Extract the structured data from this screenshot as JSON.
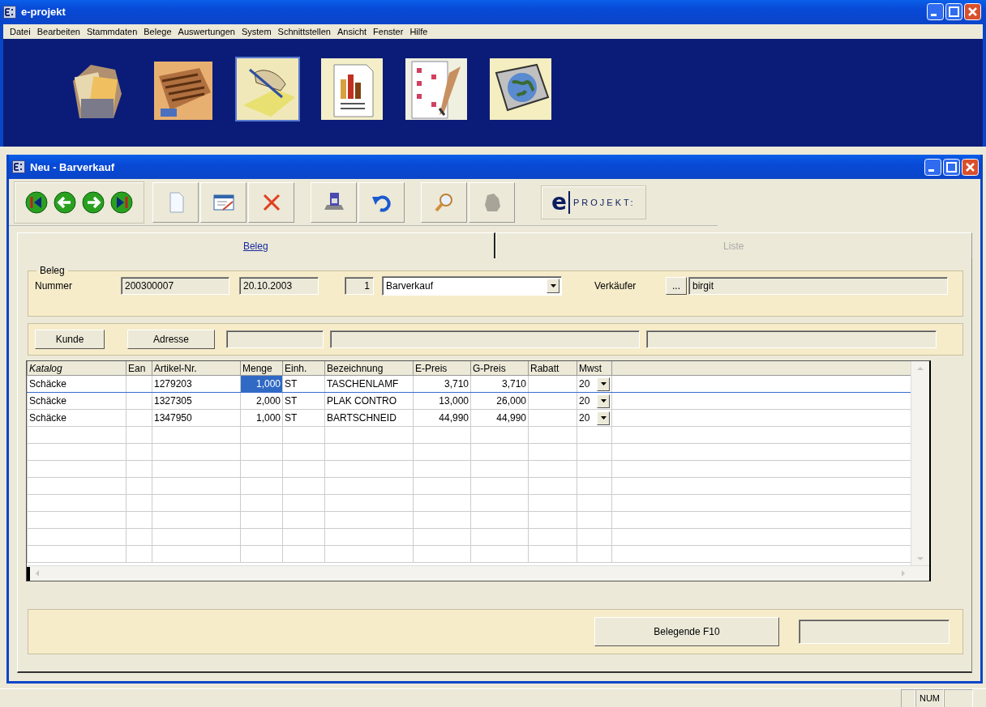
{
  "app": {
    "title": "e-projekt"
  },
  "menu": [
    {
      "label": "Datei"
    },
    {
      "label": "Bearbeiten"
    },
    {
      "label": "Stammdaten"
    },
    {
      "label": "Belege"
    },
    {
      "label": "Auswertungen"
    },
    {
      "label": "System"
    },
    {
      "label": "Schnittstellen"
    },
    {
      "label": "Ansicht"
    },
    {
      "label": "Fenster"
    },
    {
      "label": "Hilfe"
    }
  ],
  "document_window": {
    "title": "Neu - Barverkauf",
    "logo_mark": "e",
    "logo_text": "PROJEKT:"
  },
  "tabs": [
    {
      "label": "Beleg",
      "selected": true
    },
    {
      "label": "Liste",
      "selected": false
    }
  ],
  "beleg": {
    "group_title": "Beleg",
    "number_label": "Nummer",
    "number": "200300007",
    "date": "20.10.2003",
    "counter": "1",
    "type": "Barverkauf",
    "seller_label": "Verkäufer",
    "seller_button": "...",
    "seller": "birgit",
    "buttons": [
      "Kunde",
      "Adresse"
    ]
  },
  "grid": {
    "columns": [
      {
        "label": "Katalog",
        "kind": "text"
      },
      {
        "label": "Ean",
        "kind": "text"
      },
      {
        "label": "Artikel-Nr.",
        "kind": "text"
      },
      {
        "label": "Menge",
        "kind": "number"
      },
      {
        "label": "Einh.",
        "kind": "text"
      },
      {
        "label": "Bezeichnung",
        "kind": "text"
      },
      {
        "label": "E-Preis",
        "kind": "number"
      },
      {
        "label": "G-Preis",
        "kind": "number"
      },
      {
        "label": "Rabatt",
        "kind": "number"
      },
      {
        "label": "Mwst",
        "kind": "select"
      }
    ],
    "rows": [
      {
        "selected": true,
        "cells": [
          {
            "text": "Schäcke",
            "selected": false
          },
          {
            "text": "",
            "selected": false
          },
          {
            "text": "1279203",
            "selected": false
          },
          {
            "text": "1,000",
            "selected": true
          },
          {
            "text": "ST",
            "selected": false
          },
          {
            "text": "TASCHENLAMF",
            "selected": false
          },
          {
            "text": "3,710",
            "selected": false
          },
          {
            "text": "3,710",
            "selected": false
          },
          {
            "text": "",
            "selected": false
          },
          {
            "text": "20",
            "selected": false
          }
        ]
      },
      {
        "selected": false,
        "cells": [
          {
            "text": "Schäcke",
            "selected": false
          },
          {
            "text": "",
            "selected": false
          },
          {
            "text": "1327305",
            "selected": false
          },
          {
            "text": "2,000",
            "selected": false
          },
          {
            "text": "ST",
            "selected": false
          },
          {
            "text": "PLAK CONTRO",
            "selected": false
          },
          {
            "text": "13,000",
            "selected": false
          },
          {
            "text": "26,000",
            "selected": false
          },
          {
            "text": "",
            "selected": false
          },
          {
            "text": "20",
            "selected": false
          }
        ]
      },
      {
        "selected": false,
        "cells": [
          {
            "text": "Schäcke",
            "selected": false
          },
          {
            "text": "",
            "selected": false
          },
          {
            "text": "1347950",
            "selected": false
          },
          {
            "text": "1,000",
            "selected": false
          },
          {
            "text": "ST",
            "selected": false
          },
          {
            "text": "BARTSCHNEID",
            "selected": false
          },
          {
            "text": "44,990",
            "selected": false
          },
          {
            "text": "44,990",
            "selected": false
          },
          {
            "text": "",
            "selected": false
          },
          {
            "text": "20",
            "selected": false
          }
        ]
      }
    ]
  },
  "footer": {
    "button": "Belegende F10"
  },
  "status_bar": {
    "num_indicator": "NUM"
  }
}
